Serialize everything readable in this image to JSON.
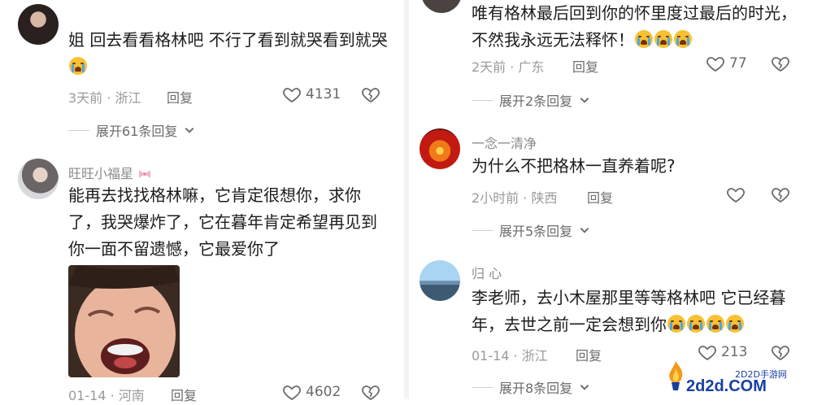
{
  "left_comments": [
    {
      "username": "",
      "text": "姐 回去看看格林吧 不行了看到就哭看到就哭",
      "time": "3天前",
      "location": "浙江",
      "reply_label": "回复",
      "likes": "4131",
      "expand_label": "展开61条回复"
    },
    {
      "username": "旺旺小福星",
      "text": "能再去找找格林嘛，它肯定很想你，求你了，我哭爆炸了，它在暮年肯定希望再见到你一面不留遗憾，它最爱你了",
      "time": "01-14",
      "location": "河南",
      "reply_label": "回复",
      "likes": "4602"
    }
  ],
  "right_comments": [
    {
      "text": "唯有格林最后回到你的怀里度过最后的时光，不然我永远无法释怀！",
      "time": "2天前",
      "location": "广东",
      "reply_label": "回复",
      "likes": "77",
      "expand_label": "展开2条回复"
    },
    {
      "username": "一念一清净",
      "text": "为什么不把格林一直养着呢?",
      "time": "2小时前",
      "location": "陕西",
      "reply_label": "回复",
      "likes": "",
      "expand_label": "展开5条回复"
    },
    {
      "username": "归 心",
      "text": "李老师，去小木屋那里等等格林吧 它已经暮年，去世之前一定会想到你",
      "time": "01-14",
      "location": "浙江",
      "reply_label": "回复",
      "likes": "213",
      "expand_label": "展开8条回复"
    }
  ],
  "watermark": {
    "small": "2D2D手游网",
    "big": "2d2d.COM"
  },
  "colors": {
    "text": "#1c1c1c",
    "meta": "#9a9a9a",
    "watermark": "#1a3fa0"
  }
}
